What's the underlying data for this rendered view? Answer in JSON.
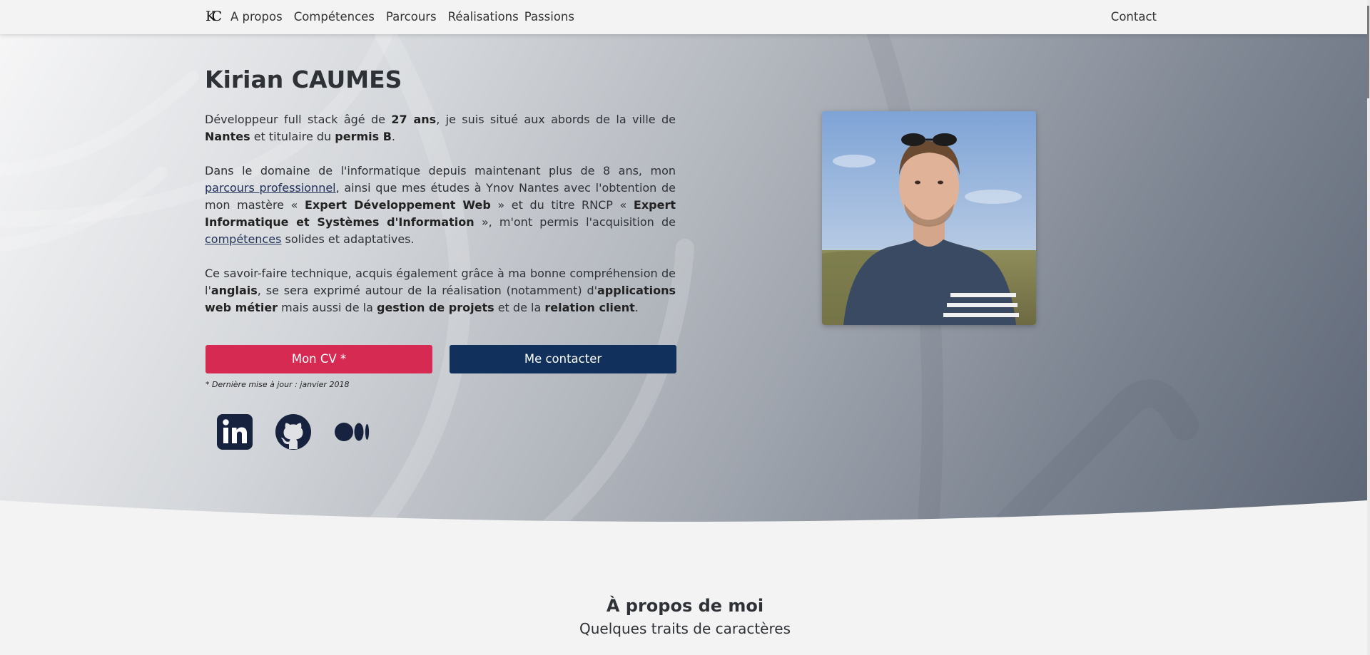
{
  "header": {
    "logo": "KC",
    "nav": [
      "A propos",
      "Compétences",
      "Parcours",
      "Réalisations",
      "Passions"
    ],
    "contact": "Contact"
  },
  "hero": {
    "name": "Kirian CAUMES",
    "p1": {
      "t1": "Développeur full stack âgé de ",
      "b1": "27 ans",
      "t2": ", je suis situé aux abords de la ville de ",
      "b2": "Nantes",
      "t3": " et titulaire du ",
      "b3": "permis B",
      "t4": "."
    },
    "p2": {
      "t1": "Dans le domaine de l'informatique depuis maintenant plus de 8 ans, mon ",
      "link1": "parcours professionnel",
      "t2": ", ainsi que mes études à Ynov Nantes avec l'obtention de mon mastère « ",
      "b1": "Expert Développement Web",
      "t3": " » et du titre RNCP « ",
      "b2": "Expert Informatique et Systèmes d'Information",
      "t4": " », m'ont permis l'acquisition de ",
      "link2": "compétences",
      "t5": " solides et adaptatives."
    },
    "p3": {
      "t1": "Ce savoir-faire technique, acquis également grâce à ma bonne compréhension de l'",
      "b1": "anglais",
      "t2": ", se sera exprimé autour de la réalisation (notamment) d'",
      "b2": "applications web métier",
      "t3": " mais aussi de la ",
      "b3": "gestion de projets",
      "t4": " et de la ",
      "b4": "relation client",
      "t5": "."
    },
    "cv_button": "Mon CV *",
    "contact_button": "Me contacter",
    "cv_note": "* Dernière mise à jour : janvier 2018",
    "social_icons": [
      "linkedin-icon",
      "github-icon",
      "medium-icon"
    ]
  },
  "about": {
    "title": "À propos de moi",
    "subtitle": "Quelques traits de caractères"
  },
  "colors": {
    "accent_red": "#d72a52",
    "navy": "#12305c",
    "icon_dark": "#17223f"
  }
}
